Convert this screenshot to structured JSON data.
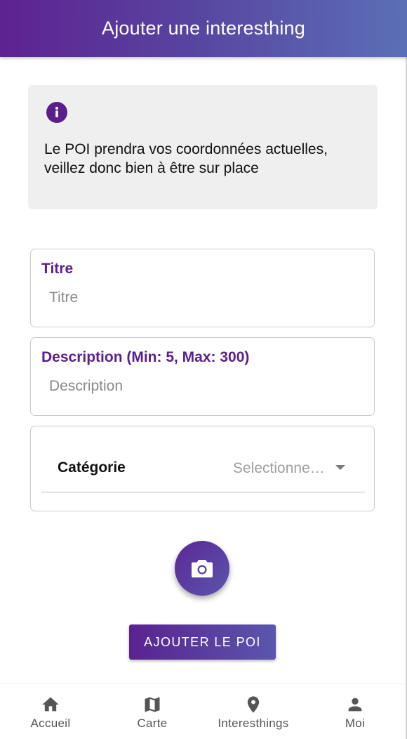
{
  "header": {
    "title": "Ajouter une interesthing"
  },
  "info": {
    "icon": "info-icon",
    "text": "Le POI prendra vos coordonnées actuelles, veillez donc bien à être sur place"
  },
  "form": {
    "title_field": {
      "label": "Titre",
      "placeholder": "Titre",
      "value": ""
    },
    "description_field": {
      "label": "Description (Min: 5, Max: 300)",
      "placeholder": "Description",
      "value": ""
    },
    "category_field": {
      "label": "Catégorie",
      "selected": "Selectionne…"
    },
    "camera_button_icon": "camera-icon",
    "submit_label": "AJOUTER LE POI"
  },
  "bottom_nav": {
    "items": [
      {
        "label": "Accueil",
        "icon": "home-icon"
      },
      {
        "label": "Carte",
        "icon": "map-icon"
      },
      {
        "label": "Interesthings",
        "icon": "location-pin-icon"
      },
      {
        "label": "Moi",
        "icon": "person-icon"
      }
    ]
  },
  "colors": {
    "primary": "#5a1f8c",
    "header_gradient_start": "#5e2291",
    "header_gradient_end": "#5b6fb6",
    "info_background": "#efefef"
  }
}
